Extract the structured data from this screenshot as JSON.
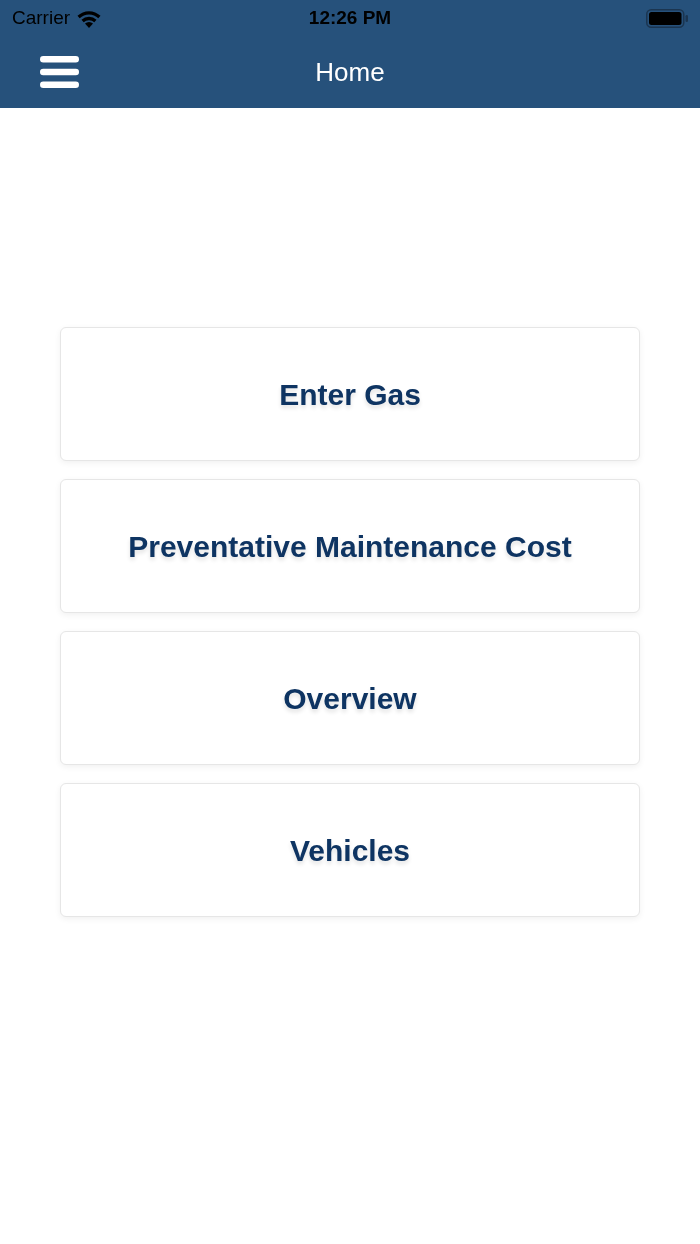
{
  "status_bar": {
    "carrier": "Carrier",
    "time": "12:26 PM"
  },
  "nav_bar": {
    "title": "Home"
  },
  "menu": [
    {
      "label": "Enter Gas"
    },
    {
      "label": "Preventative Maintenance Cost"
    },
    {
      "label": "Overview"
    },
    {
      "label": "Vehicles"
    }
  ]
}
